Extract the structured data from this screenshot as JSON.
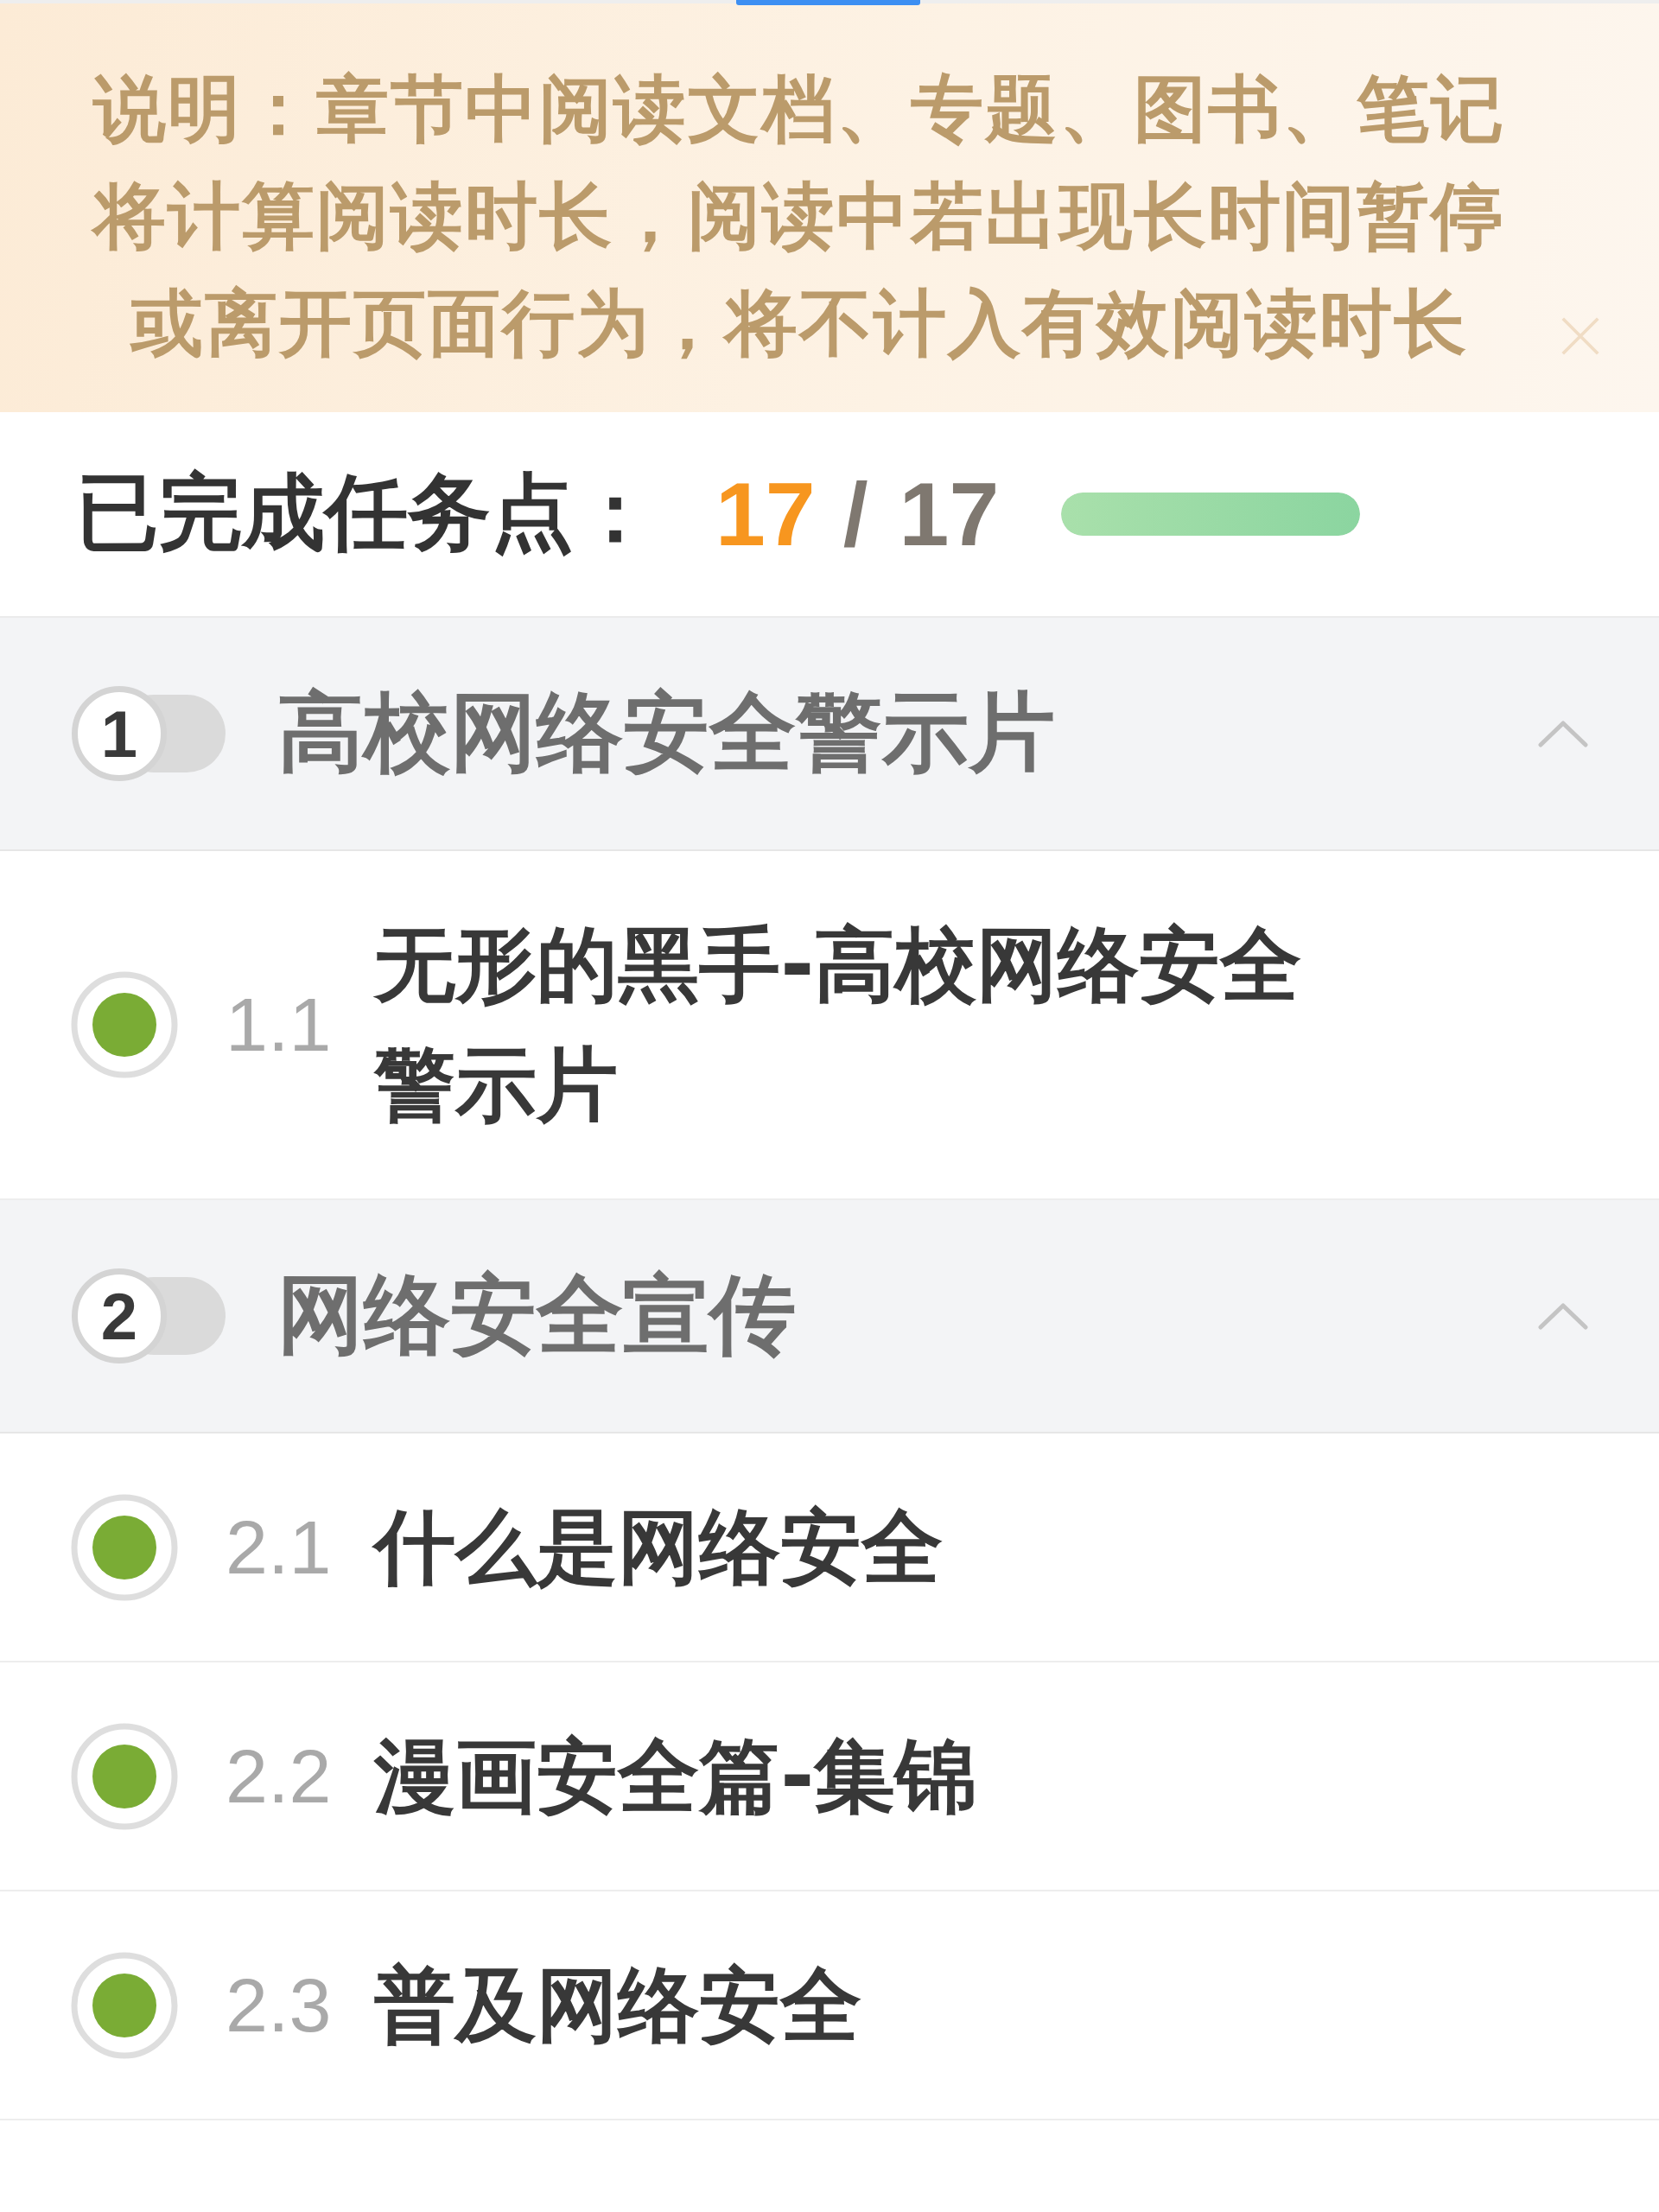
{
  "notice": {
    "text": "说明：章节中阅读文档、专题、图书、笔记将计算阅读时长，阅读中若出现长时间暂停或离开页面行为，将不计入有效阅读时长"
  },
  "progress": {
    "label": "已完成任务点：",
    "completed": "17",
    "separator": "/",
    "total": "17",
    "level": 1
  },
  "chapters": [
    {
      "number": "1",
      "title": "高校网络安全警示片",
      "expanded": true,
      "items": [
        {
          "number": "1.1",
          "title": "无形的黑手-高校网络安全警示片",
          "completed": true
        }
      ]
    },
    {
      "number": "2",
      "title": "网络安全宣传",
      "expanded": true,
      "items": [
        {
          "number": "2.1",
          "title": "什么是网络安全",
          "completed": true
        },
        {
          "number": "2.2",
          "title": "漫画安全篇-集锦",
          "completed": true
        },
        {
          "number": "2.3",
          "title": "普及网络安全",
          "completed": true
        }
      ]
    }
  ]
}
